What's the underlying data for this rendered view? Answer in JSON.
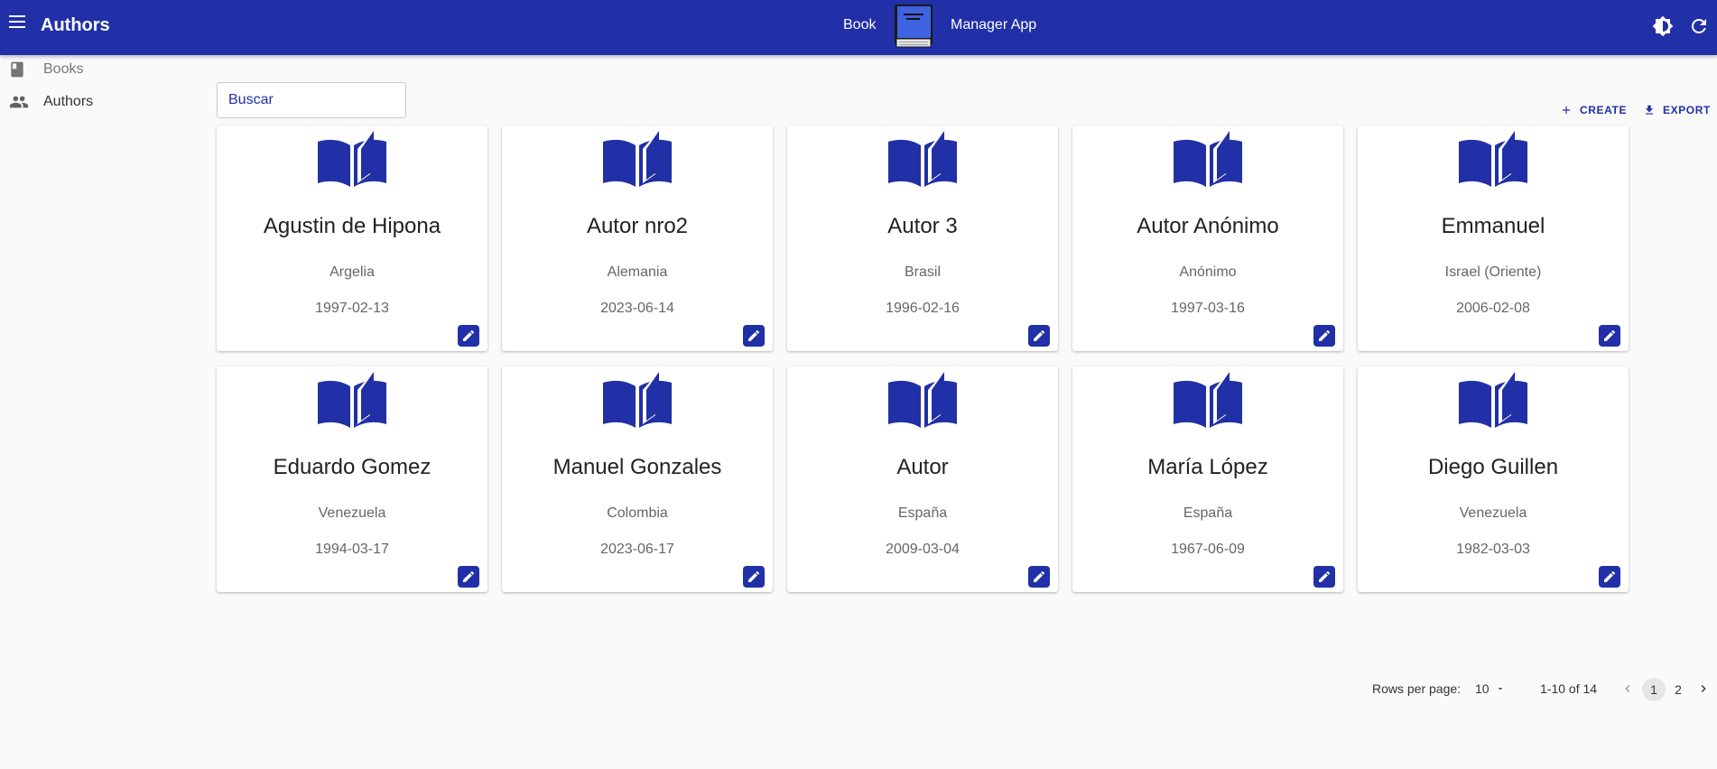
{
  "header": {
    "page_title": "Authors",
    "brand_left": "Book",
    "brand_right": "Manager App",
    "accent_color": "#2130a6"
  },
  "sidebar": {
    "items": [
      {
        "label": "Books",
        "icon": "book-icon"
      },
      {
        "label": "Authors",
        "icon": "people-icon"
      }
    ]
  },
  "search": {
    "placeholder": "Buscar",
    "value": ""
  },
  "toolbar": {
    "create_label": "CREATE",
    "export_label": "EXPORT"
  },
  "authors": [
    {
      "name": "Agustin de Hipona",
      "country": "Argelia",
      "date": "1997-02-13"
    },
    {
      "name": "Autor nro2",
      "country": "Alemania",
      "date": "2023-06-14"
    },
    {
      "name": "Autor 3",
      "country": "Brasil",
      "date": "1996-02-16"
    },
    {
      "name": "Autor Anónimo",
      "country": "Anónimo",
      "date": "1997-03-16"
    },
    {
      "name": "Emmanuel",
      "country": "Israel (Oriente)",
      "date": "2006-02-08"
    },
    {
      "name": "Eduardo Gomez",
      "country": "Venezuela",
      "date": "1994-03-17"
    },
    {
      "name": "Manuel Gonzales",
      "country": "Colombia",
      "date": "2023-06-17"
    },
    {
      "name": "Autor",
      "country": "España",
      "date": "2009-03-04"
    },
    {
      "name": "María López",
      "country": "España",
      "date": "1967-06-09"
    },
    {
      "name": "Diego Guillen",
      "country": "Venezuela",
      "date": "1982-03-03"
    }
  ],
  "pagination": {
    "rows_label": "Rows per page:",
    "rows_value": "10",
    "range": "1-10 of 14",
    "pages": [
      "1",
      "2"
    ],
    "current_page": "1"
  }
}
